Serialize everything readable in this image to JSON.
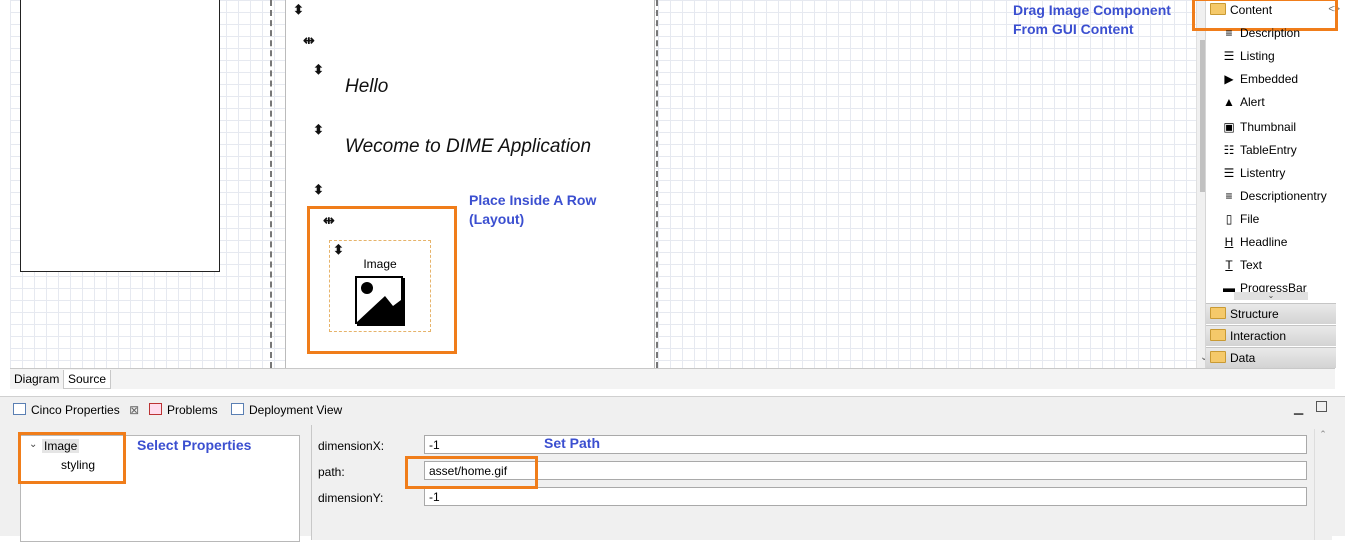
{
  "canvas": {
    "text_hello": "Hello",
    "text_welcome": "Wecome to DIME Application",
    "image_component_label": "Image"
  },
  "annotations": {
    "drag_line1": "Drag Image Component",
    "drag_line2": "From GUI Content",
    "place_line1": "Place Inside A Row",
    "place_line2": "(Layout)",
    "select_properties": "Select Properties",
    "set_path": "Set Path"
  },
  "palette": {
    "drawer_content": "Content",
    "items": [
      {
        "icon": "≡",
        "label": "Description"
      },
      {
        "icon": "☰",
        "label": "Listing"
      },
      {
        "icon": "▶",
        "label": "Embedded"
      },
      {
        "icon": "▲",
        "label": "Alert"
      },
      {
        "icon": "▣",
        "label": "Thumbnail"
      },
      {
        "icon": "☷",
        "label": "TableEntry"
      },
      {
        "icon": "☰",
        "label": "Listentry"
      },
      {
        "icon": "≡",
        "label": "Descriptionentry"
      },
      {
        "icon": "▯",
        "label": "File"
      },
      {
        "icon": "H",
        "label": "Headline"
      },
      {
        "icon": "T",
        "label": "Text"
      },
      {
        "icon": "▬",
        "label": "ProgressBar"
      }
    ],
    "drawers": [
      "Structure",
      "Interaction",
      "Data"
    ]
  },
  "editor_tabs": [
    "Diagram",
    "Source"
  ],
  "views": {
    "tabs": [
      "Cinco Properties",
      "Problems",
      "Deployment View"
    ]
  },
  "tree": {
    "root": "Image",
    "child": "styling"
  },
  "properties": {
    "dimensionX_label": "dimensionX:",
    "dimensionX_value": "-1",
    "path_label": "path:",
    "path_value": "asset/home.gif",
    "dimensionY_label": "dimensionY:",
    "dimensionY_value": "-1"
  },
  "colors": {
    "highlight": "#f07d1a",
    "annotation_text": "#3b4fd0"
  }
}
